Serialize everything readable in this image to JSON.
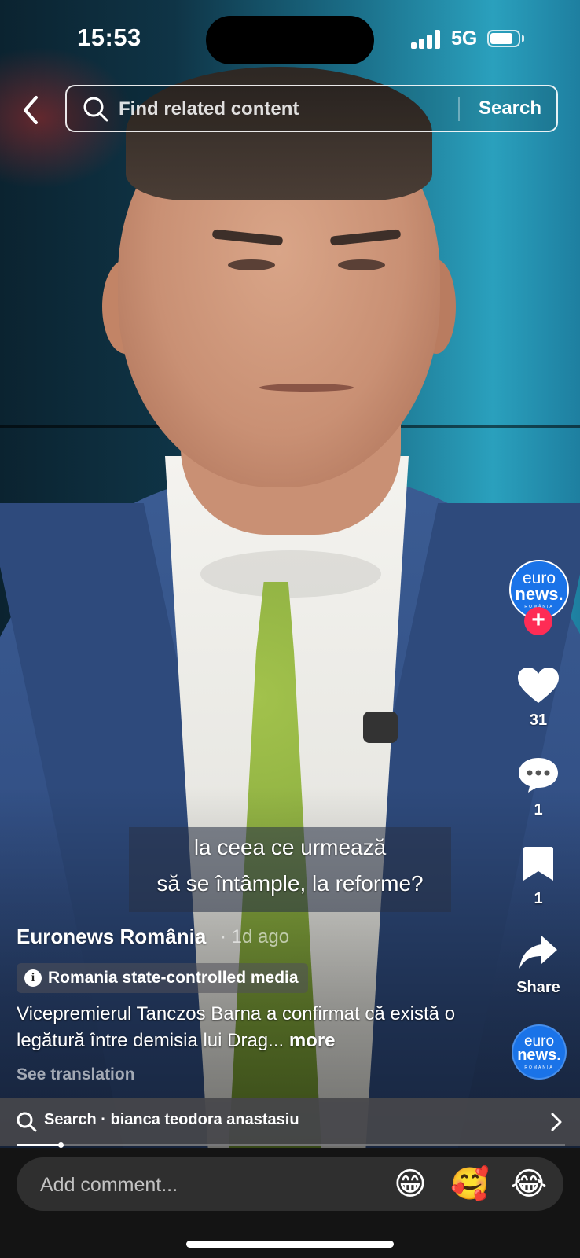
{
  "status_bar": {
    "time": "15:53",
    "network": "5G"
  },
  "top_search": {
    "placeholder": "Find related content",
    "button_label": "Search"
  },
  "caption": {
    "line1": "la ceea ce urmează",
    "line2": "să se întâmple, la reforme?"
  },
  "actions": {
    "author_logo_top": "euro",
    "author_logo_bottom": "news.",
    "author_logo_sub": "ROMÂNIA",
    "follow_symbol": "+",
    "like_count": "31",
    "comment_count": "1",
    "save_count": "1",
    "share_label": "Share"
  },
  "post": {
    "author": "Euronews România",
    "time": "· 1d ago",
    "state_media_label": "Romania state-controlled media",
    "description": "Vicepremierul Tanczos Barna a confirmat că există o legătură între demisia lui Drag...",
    "more_label": "more",
    "see_translation": "See translation"
  },
  "search_suggestion": {
    "text": "Search · bianca teodora anastasiu"
  },
  "playback_progress": 0.08,
  "comment_bar": {
    "placeholder": "Add comment...",
    "emojis": [
      "😁",
      "🥰",
      "😂"
    ]
  },
  "colors": {
    "accent_red": "#fe2c55",
    "euronews_blue": "#1a73e8"
  },
  "icons": [
    "back-icon",
    "search-icon",
    "heart-icon",
    "comment-icon",
    "bookmark-icon",
    "share-icon",
    "chevron-right-icon",
    "info-icon"
  ]
}
